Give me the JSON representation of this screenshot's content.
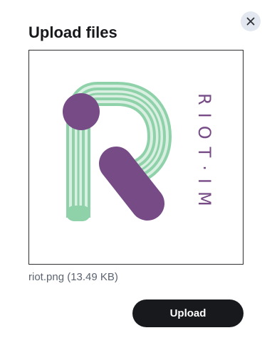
{
  "dialog": {
    "title": "Upload files",
    "close_icon": "close-icon",
    "preview": {
      "logo_icon": "riot-logo-icon",
      "brand_text": "RIOT·IM",
      "colors": {
        "green": "#8fd2aa",
        "green_light": "#d9efe1",
        "purple": "#764b86"
      }
    },
    "file_info": "riot.png (13.49 KB)",
    "upload_label": "Upload"
  },
  "colors": {
    "button_bg": "#17191c",
    "close_bg": "#e3e8f0",
    "text_primary": "#17191c",
    "text_secondary": "#5c6470"
  }
}
